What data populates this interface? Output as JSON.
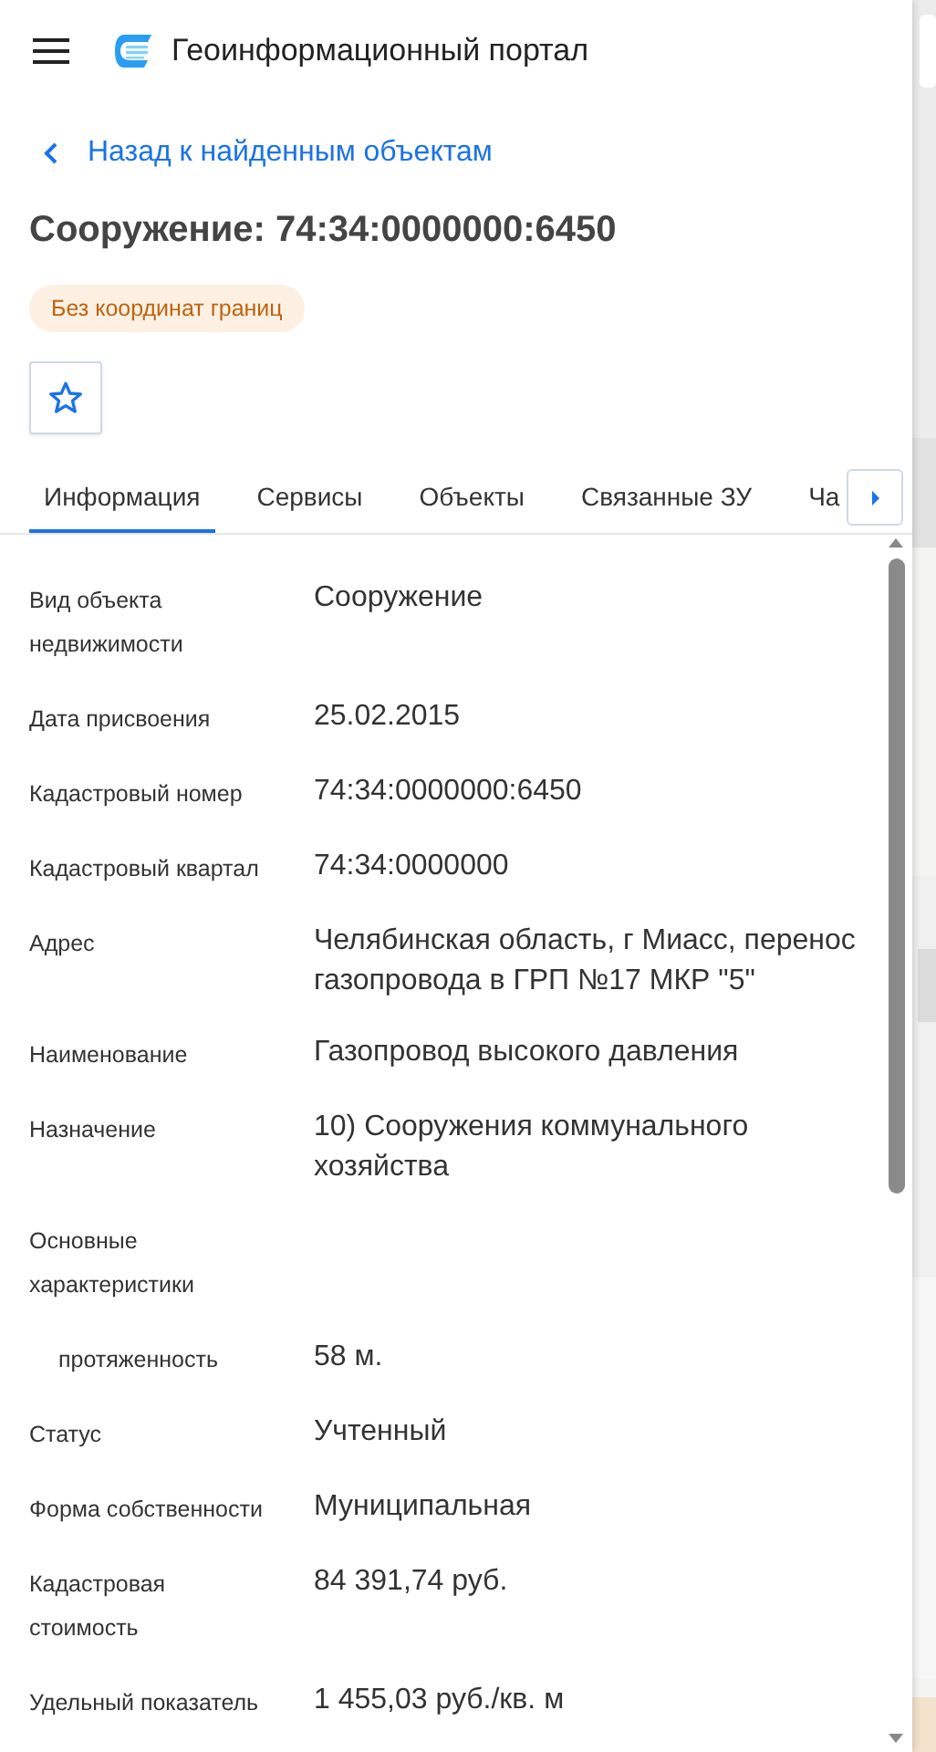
{
  "header": {
    "title": "Геоинформационный портал"
  },
  "back_link": "Назад к найденным объектам",
  "title": "Сооружение: 74:34:0000000:6450",
  "chip": "Без координат границ",
  "favorite": {
    "on": false
  },
  "tabs": [
    {
      "label": "Информация",
      "selected": true
    },
    {
      "label": "Сервисы",
      "selected": false
    },
    {
      "label": "Объекты",
      "selected": false
    },
    {
      "label": "Связанные ЗУ",
      "selected": false
    },
    {
      "label": "Ча",
      "selected": false
    }
  ],
  "rows": [
    {
      "label": "Вид объекта недвижимости",
      "value": "Сооружение"
    },
    {
      "label": "Дата присвоения",
      "value": "25.02.2015"
    },
    {
      "label": "Кадастровый номер",
      "value": "74:34:0000000:6450"
    },
    {
      "label": "Кадастровый квартал",
      "value": "74:34:0000000"
    },
    {
      "label": "Адрес",
      "value": "Челябинская область, г Миасс, перенос газопровода в ГРП №17 МКР \"5\""
    },
    {
      "label": "Наименование",
      "value": "Газопровод высокого давления"
    },
    {
      "label": "Назначение",
      "value": "10) Сооружения коммунального хозяйства"
    },
    {
      "label": "Основные характеристики",
      "children": [
        {
          "label": "протяженность",
          "value": "58 м."
        }
      ]
    },
    {
      "label": "Статус",
      "value": "Учтенный"
    },
    {
      "label": "Форма собственности",
      "value": "Муниципальная"
    },
    {
      "label": "Кадастровая стоимость",
      "value": "84 391,74 руб."
    },
    {
      "label": "Удельный показатель",
      "value": "1 455,03 руб./кв. м"
    }
  ]
}
